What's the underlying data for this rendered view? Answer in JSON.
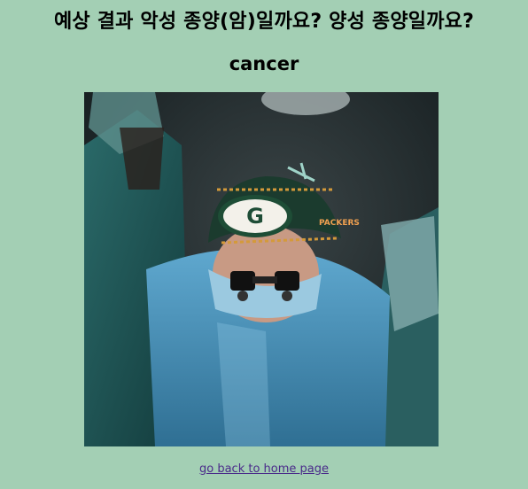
{
  "page": {
    "question": "예상 결과 악성 종양(암)일까요? 양성 종양일까요?",
    "result": "cancer",
    "image_alt": "surgeon in operating room",
    "home_link": "go back to home page"
  },
  "colors": {
    "background": "#a3cfb4",
    "link": "#4a2a8a"
  }
}
